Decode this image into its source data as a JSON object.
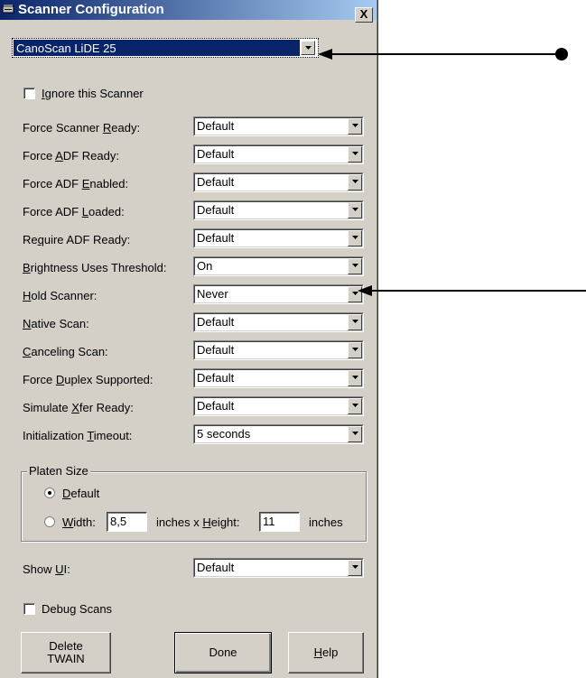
{
  "window": {
    "title": "Scanner Configuration",
    "close_label": "X"
  },
  "scanner_select": {
    "value": "CanoScan LiDE 25"
  },
  "ignore_scanner": {
    "label_pre": "",
    "label_u": "I",
    "label_post": "gnore this Scanner",
    "checked": false
  },
  "settings": [
    {
      "pre": "Force Scanner ",
      "u": "R",
      "post": "eady:",
      "value": "Default"
    },
    {
      "pre": "Force ",
      "u": "A",
      "post": "DF Ready:",
      "value": "Default"
    },
    {
      "pre": "Force ADF ",
      "u": "E",
      "post": "nabled:",
      "value": "Default"
    },
    {
      "pre": "Force ADF ",
      "u": "L",
      "post": "oaded:",
      "value": "Default"
    },
    {
      "pre": "Re",
      "u": "q",
      "post": "uire ADF Ready:",
      "value": "Default"
    },
    {
      "pre": "",
      "u": "B",
      "post": "rightness Uses Threshold:",
      "value": "On"
    },
    {
      "pre": "",
      "u": "H",
      "post": "old Scanner:",
      "value": "Never"
    },
    {
      "pre": "",
      "u": "N",
      "post": "ative Scan:",
      "value": "Default"
    },
    {
      "pre": "",
      "u": "C",
      "post": "anceling Scan:",
      "value": "Default"
    },
    {
      "pre": "Force ",
      "u": "D",
      "post": "uplex Supported:",
      "value": "Default"
    },
    {
      "pre": "Simulate ",
      "u": "X",
      "post": "fer Ready:",
      "value": "Default"
    },
    {
      "pre": "Initialization ",
      "u": "T",
      "post": "imeout:",
      "value": "5 seconds"
    }
  ],
  "platen": {
    "group_title": "Platen Size",
    "default_pre": "",
    "default_u": "D",
    "default_post": "efault",
    "width_pre": "",
    "width_u": "W",
    "width_post": "idth:",
    "width_value": "8,5",
    "mid_pre": "inches x ",
    "mid_u": "H",
    "mid_post": "eight:",
    "height_value": "11",
    "unit": "inches",
    "selected": "Default"
  },
  "show_ui": {
    "pre": "Show ",
    "u": "U",
    "post": "I:",
    "value": "Default"
  },
  "debug_scans": {
    "label": "Debug Scans",
    "checked": false
  },
  "buttons": {
    "delete_line1": "Delete",
    "delete_line2": "TWAIN",
    "done": "Done",
    "help_u": "H",
    "help_post": "elp"
  },
  "colors": {
    "titlebar_start": "#0a246a",
    "titlebar_end": "#a6caf0",
    "face": "#d4d0c8"
  }
}
